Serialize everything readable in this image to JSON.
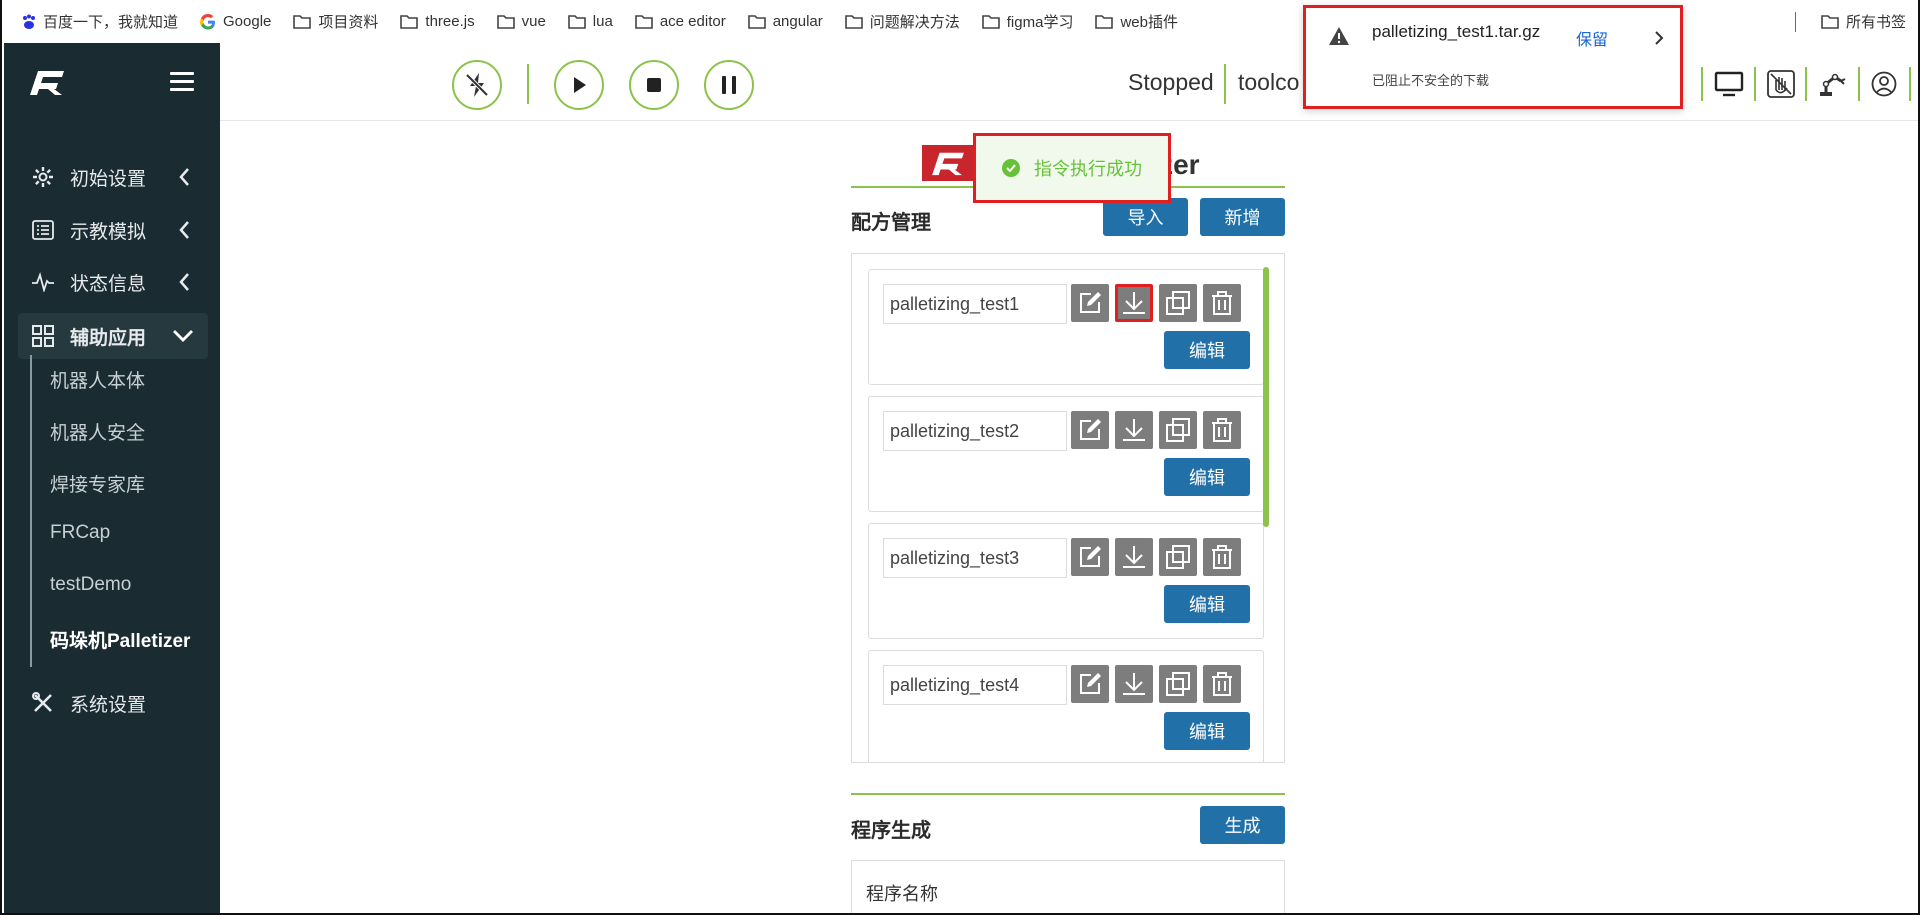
{
  "bookmarks": {
    "items": [
      {
        "label": "百度一下，我就知道",
        "icon": "baidu-icon"
      },
      {
        "label": "Google",
        "icon": "google-icon"
      },
      {
        "label": "项目资料",
        "icon": "folder-icon"
      },
      {
        "label": "three.js",
        "icon": "folder-icon"
      },
      {
        "label": "vue",
        "icon": "folder-icon"
      },
      {
        "label": "lua",
        "icon": "folder-icon"
      },
      {
        "label": "ace editor",
        "icon": "folder-icon"
      },
      {
        "label": "angular",
        "icon": "folder-icon"
      },
      {
        "label": "问题解决方法",
        "icon": "folder-icon"
      },
      {
        "label": "figma学习",
        "icon": "folder-icon"
      },
      {
        "label": "web插件",
        "icon": "folder-icon"
      }
    ],
    "all_bookmarks": "所有书签"
  },
  "sidebar": {
    "menu": [
      {
        "label": "初始设置",
        "icon": "gear-icon"
      },
      {
        "label": "示教模拟",
        "icon": "list-icon"
      },
      {
        "label": "状态信息",
        "icon": "pulse-icon"
      },
      {
        "label": "辅助应用",
        "icon": "grid-icon"
      }
    ],
    "sub_items": [
      {
        "label": "机器人本体"
      },
      {
        "label": "机器人安全"
      },
      {
        "label": "焊接专家库"
      },
      {
        "label": "FRCap"
      },
      {
        "label": "testDemo"
      },
      {
        "label": "码垛机Palletizer"
      }
    ],
    "system_settings": "系统设置"
  },
  "toolbar": {
    "status": "Stopped",
    "tool_text": "toolco"
  },
  "main": {
    "title_suffix": "tizer",
    "recipe_section": {
      "title": "配方管理",
      "import_label": "导入",
      "add_label": "新增",
      "edit_label": "编辑",
      "recipes": [
        {
          "name": "palletizing_test1"
        },
        {
          "name": "palletizing_test2"
        },
        {
          "name": "palletizing_test3"
        },
        {
          "name": "palletizing_test4"
        }
      ]
    },
    "program_section": {
      "title": "程序生成",
      "generate_label": "生成",
      "program_name_label": "程序名称"
    }
  },
  "toast": {
    "message": "指令执行成功"
  },
  "download_popup": {
    "filename": "palletizing_test1.tar.gz",
    "status": "已阻止不安全的下载",
    "keep_label": "保留"
  },
  "colors": {
    "sidebar_bg": "#1a2b31",
    "accent_green": "#8bc34a",
    "button_blue": "#2170a8",
    "highlight_red": "#e02020",
    "brand_red": "#c9252c"
  }
}
